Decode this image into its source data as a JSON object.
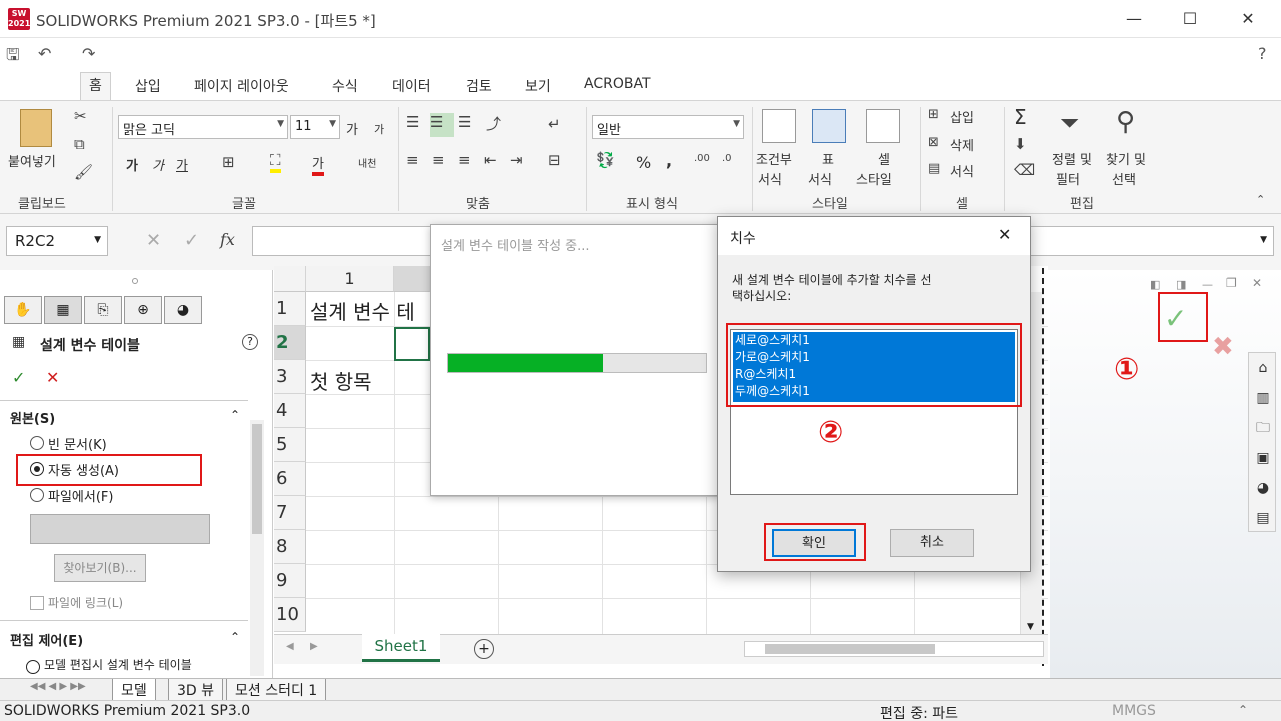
{
  "window": {
    "title": "SOLIDWORKS Premium 2021 SP3.0 - [파트5 *]",
    "logo_text": "SW 2021",
    "minimize": "—",
    "maximize": "☐",
    "close": "✕"
  },
  "qat": {
    "save": "🖫",
    "undo": "↶",
    "redo": "↷",
    "help": "?"
  },
  "ribbon_tabs": [
    "홈",
    "삽입",
    "페이지 레이아웃",
    "수식",
    "데이터",
    "검토",
    "보기",
    "ACROBAT"
  ],
  "ribbon": {
    "clipboard": {
      "paste_label": "붙여넣기",
      "group_label": "클립보드"
    },
    "font": {
      "font_name": "맑은 고딕",
      "font_size": "11",
      "group_label": "글꼴",
      "bold": "가",
      "italic": "가",
      "underline": "가",
      "grow": "가",
      "shrink": "가",
      "phonetic": "내천"
    },
    "alignment": {
      "group_label": "맞춤"
    },
    "number": {
      "format": "일반",
      "percent": "%",
      "comma": ",",
      "group_label": "표시 형식"
    },
    "styles": {
      "conditional_line1": "조건부",
      "conditional_line2": "서식",
      "table_line1": "표",
      "table_line2": "서식",
      "cell_line1": "셀",
      "cell_line2": "스타일",
      "group_label": "스타일"
    },
    "cells": {
      "insert": "삽입",
      "delete": "삭제",
      "format": "서식",
      "group_label": "셀"
    },
    "editing": {
      "sort_line1": "정렬 및",
      "sort_line2": "필터",
      "find_line1": "찾기 및",
      "find_line2": "선택",
      "group_label": "편집",
      "sum": "Σ"
    }
  },
  "formula_bar": {
    "name_box": "R2C2",
    "fx": "fx",
    "value": ""
  },
  "left_panel": {
    "title": "설계 변수 테이블",
    "help": "?",
    "ok": "✓",
    "cancel": "✕",
    "source_section": "원본(S)",
    "options": [
      {
        "label": "빈 문서(K)",
        "selected": false
      },
      {
        "label": "자동 생성(A)",
        "selected": true
      },
      {
        "label": "파일에서(F)",
        "selected": false
      }
    ],
    "browse_button": "찾아보기(B)...",
    "link_checkbox": "파일에 링크(L)",
    "edit_section": "편집 제어(E)",
    "edit_option": "모델 편집시 설계 변수 테이블"
  },
  "spreadsheet": {
    "column_header": "1",
    "rows": [
      "1",
      "2",
      "3",
      "4",
      "5",
      "6",
      "7",
      "8",
      "9",
      "10"
    ],
    "cells": {
      "r1": "설계 변수 테",
      "r3": "첫 항목"
    },
    "sheet_tab": "Sheet1",
    "add_sheet": "+"
  },
  "progress_dialog": {
    "title": "설계 변수 테이블 작성 중...",
    "progress_fraction": 0.6
  },
  "dimension_dialog": {
    "title": "치수",
    "close": "✕",
    "prompt_line1": "새 설계 변수 테이블에 추가할 치수를 선",
    "prompt_line2": "택하십시오:",
    "items": [
      "세로@스케치1",
      "가로@스케치1",
      "R@스케치1",
      "두께@스케치1"
    ],
    "ok_button": "확인",
    "cancel_button": "취소"
  },
  "annotations": {
    "step1": "①",
    "step2": "②"
  },
  "confirm_corner": {
    "ok": "✓",
    "cancel": "✖"
  },
  "bottom_tabs": [
    "모델",
    "3D 뷰",
    "모션 스터디 1"
  ],
  "status": {
    "left": "SOLIDWORKS Premium 2021 SP3.0",
    "editing": "편집 중: 파트",
    "units": "MMGS"
  },
  "colors": {
    "accent": "#0078d7",
    "red": "#e01818",
    "progress_green": "#06b025",
    "ok_green": "#2e8b2e"
  }
}
